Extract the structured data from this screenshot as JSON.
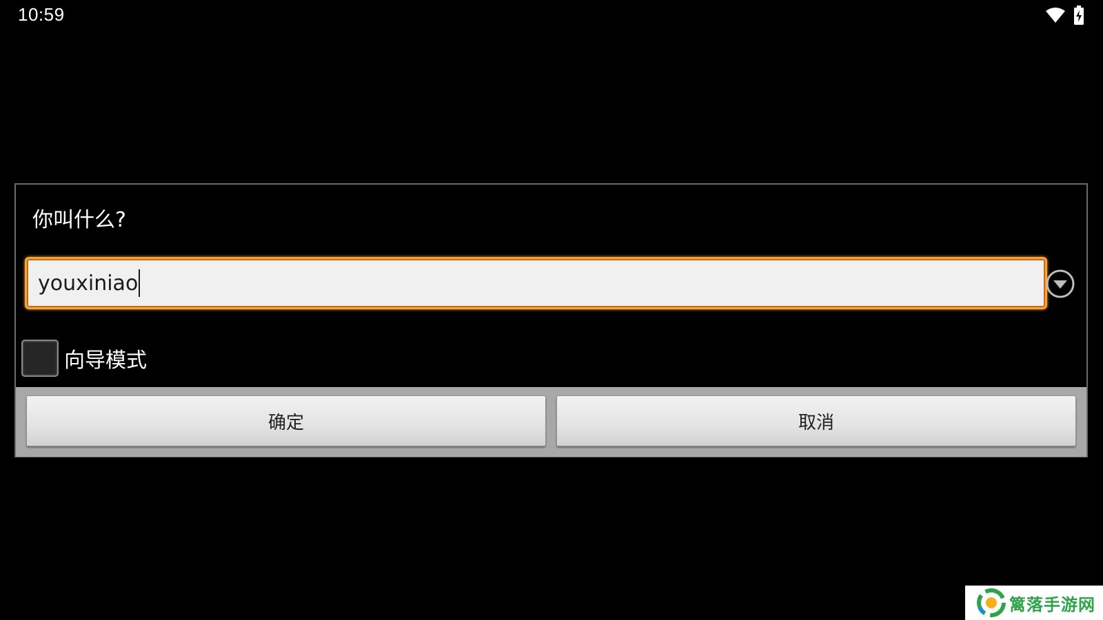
{
  "status_bar": {
    "time": "10:59",
    "wifi_icon": "wifi-icon",
    "battery_icon": "battery-charging-icon"
  },
  "dialog": {
    "title": "你叫什么?",
    "name_input": {
      "value": "youxiniao",
      "accent_color": "#f5a33b"
    },
    "dropdown_icon": "chevron-down-circle-icon",
    "wizard_checkbox": {
      "label": "向导模式",
      "checked": false
    },
    "buttons": {
      "ok_label": "确定",
      "cancel_label": "取消"
    }
  },
  "watermark": {
    "text": "篱落手游网"
  }
}
